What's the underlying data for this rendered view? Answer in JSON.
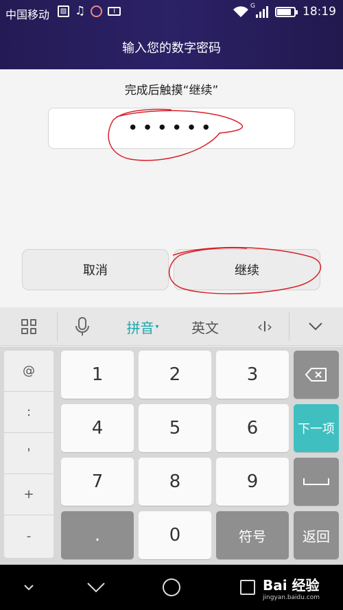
{
  "status_bar": {
    "carrier": "中国移动",
    "network_label": "G",
    "time": "18:19",
    "icons": [
      "image-icon",
      "music-icon",
      "face-icon",
      "card-icon",
      "wifi-icon",
      "signal-icon",
      "battery-icon"
    ],
    "battery_level": 0.85
  },
  "header": {
    "title": "输入您的数字密码"
  },
  "main": {
    "hint": "完成后触摸“继续”",
    "password_mask": "••••••",
    "cancel_label": "取消",
    "continue_label": "继续",
    "annotation_color": "#d9202a"
  },
  "keyboard": {
    "toolbar": {
      "pinyin_label": "拼音",
      "english_label": "英文",
      "cursor_label": "‹I›",
      "accent_color": "#19a9b0"
    },
    "symbols": [
      "@",
      ":",
      "'",
      "+",
      "-"
    ],
    "rows": [
      [
        "1",
        "2",
        "3"
      ],
      [
        "4",
        "5",
        "6"
      ],
      [
        "7",
        "8",
        "9"
      ],
      [
        ".",
        "0",
        "符号"
      ]
    ],
    "next_label": "下一项",
    "return_label": "返回",
    "next_color": "#3fbfbf"
  },
  "watermark": {
    "brand": "Bai 经验",
    "url": "jingyan.baidu.com"
  }
}
